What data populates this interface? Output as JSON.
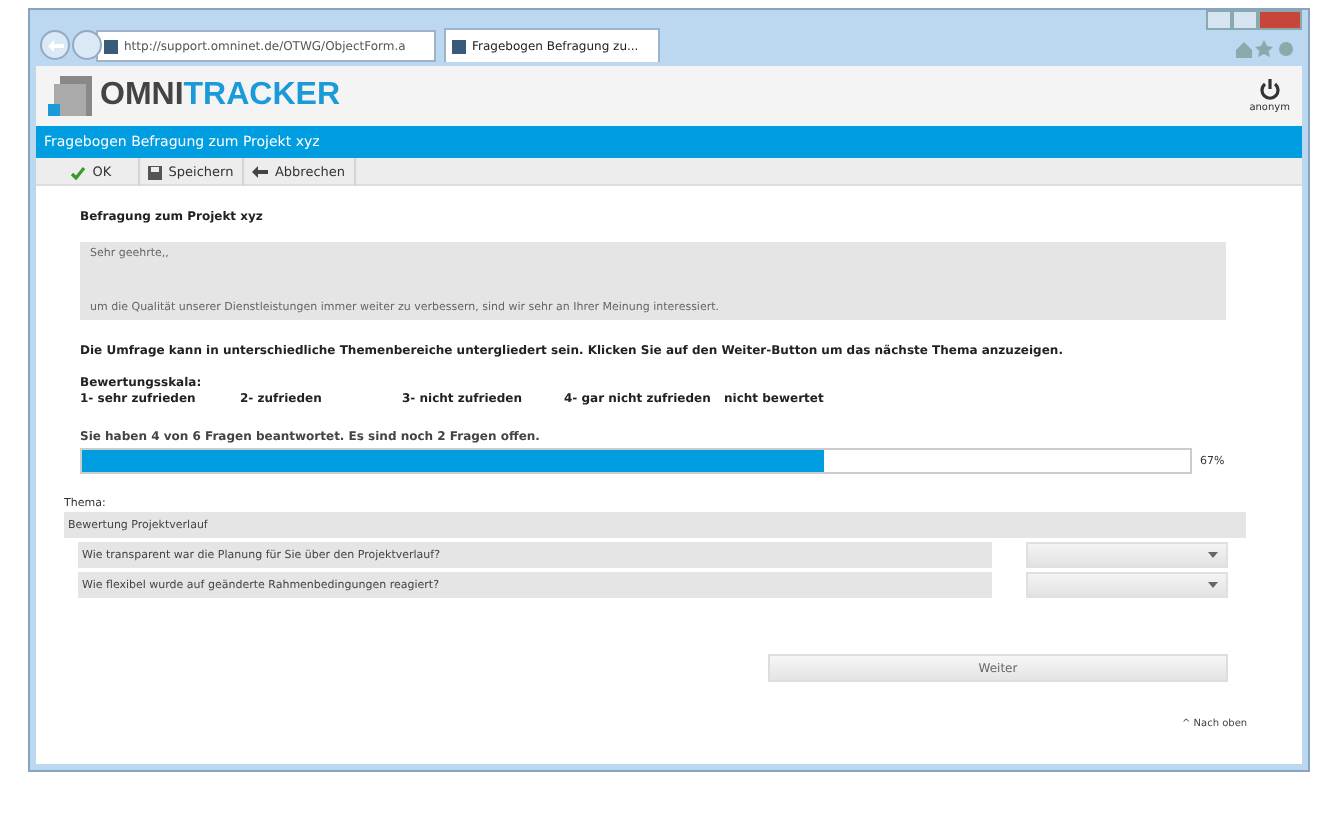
{
  "browser": {
    "address": "http://support.omninet.de/OTWG/ObjectForm.a",
    "tab": "Fragebogen Befragung zu..."
  },
  "header": {
    "logo_first": "OMNI",
    "logo_second": "TRACKER",
    "user": "anonym"
  },
  "form_title": "Fragebogen Befragung zum Projekt xyz",
  "toolbar": [
    {
      "label": "OK",
      "kind": "ok"
    },
    {
      "label": "Speichern",
      "kind": "save"
    },
    {
      "label": "Abbrechen",
      "kind": "cancel"
    }
  ],
  "heading": "Befragung zum Projekt xyz",
  "intro": {
    "greeting": "Sehr geehrte,,",
    "text": "um die Qualität unserer Dienstleistungen immer weiter zu verbessern, sind wir sehr an Ihrer Meinung interessiert."
  },
  "instruction": "Die Umfrage kann in unterschiedliche Themenbereiche untergliedert sein. Klicken Sie auf den Weiter-Button um das nächste Thema anzuzeigen.",
  "scale": {
    "title": "Bewertungsskala:",
    "items": [
      "1- sehr zufrieden",
      "2- zufrieden",
      "3- nicht zufrieden",
      "4- gar nicht zufrieden",
      "nicht bewertet"
    ]
  },
  "progress": {
    "text": "Sie haben 4 von 6 Fragen beantwortet. Es sind noch 2 Fragen offen.",
    "level": 0.67,
    "reading": "67%"
  },
  "topic": {
    "label": "Thema:",
    "name": "Bewertung Projektverlauf"
  },
  "questions": [
    {
      "text": "Wie transparent war die Planung für Sie über den Projektverlauf?"
    },
    {
      "text": "Wie flexibel wurde auf geänderte Rahmenbedingungen reagiert?"
    }
  ],
  "next_button": "Weiter",
  "top_link": "^ Nach oben"
}
